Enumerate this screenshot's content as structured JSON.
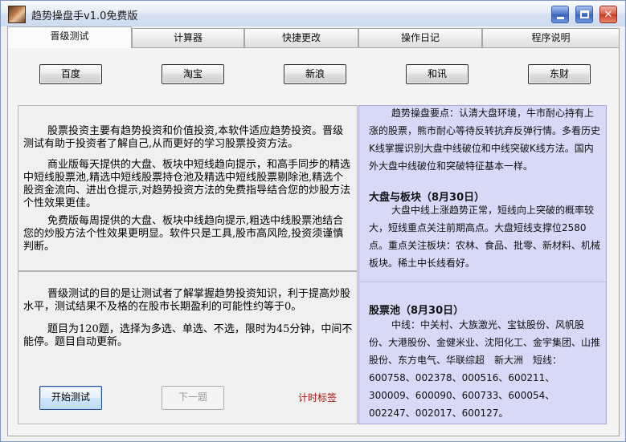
{
  "window": {
    "title": "趋势操盘手v1.0免费版"
  },
  "tabs": [
    {
      "label": "晋级测试"
    },
    {
      "label": "计算器"
    },
    {
      "label": "快捷更改"
    },
    {
      "label": "操作日记"
    },
    {
      "label": "程序说明"
    }
  ],
  "sites": [
    {
      "label": "百度"
    },
    {
      "label": "淘宝"
    },
    {
      "label": "新浪"
    },
    {
      "label": "和讯"
    },
    {
      "label": "东财"
    }
  ],
  "intro": {
    "p1": "股票投资主要有趋势投资和价值投资,本软件适应趋势投资。晋级测试有助于投资者了解自己,从而更好的学习股票投资方法。",
    "p2": "商业版每天提供的大盘、板块中短线趋向提示，和高手同步的精选中短线股票池,精选中短线股票持仓池及精选中短线股票剔除池,精选个股资金流向、进出仓提示,对趋势投资方法的免费指导结合您的炒股方法个性效果更佳。",
    "p3": "免费版每周提供的大盘、板块中线趋向提示,粗选中线股票池结合您的炒股方法个性效果更明显。软件只是工具,股市高风险,投资须谨慎判断。"
  },
  "test": {
    "p1": "晋级测试的目的是让测试者了解掌握趋势投资知识，利于提高炒股水平，测试结果不及格的在股市长期盈利的可能性约等于0。",
    "p2": "题目为120题，选择为多选、单选、不选，限时为45分钟，中间不能停。题目自动更新。",
    "start_label": "开始测试",
    "next_label": "下一题",
    "timer_label": "计时标签"
  },
  "info": {
    "key_points": "趋势操盘要点：认清大盘环境，牛市耐心持有上涨的股票，熊市耐心等待反转抗弃反弹行情。多看历史K线掌握识别大盘中线破位和中线突破K线方法。国内外大盘中线破位和突破特征基本一样。",
    "market_title": "大盘与板块（8月30日）",
    "market_text": "大盘中线上涨趋势正常，短线向上突破的概率较大，短线重点关注前期高点。大盘短线支撑位2580点。重点关注板块：农林、食品、批零、新材料、机械板块。稀土中长线看好。",
    "pool_title": "股票池（8月30日）",
    "pool_text": "中线：中关村、大族激光、宝钛股份、风帆股份、大港股份、金健米业、沈阳化工、金宇集团、山推股份、东方电气、华联综超　新大洲　短线：600758、002378、000516、600211、300009、600090、600733、600054、002247、002017、600127。"
  }
}
